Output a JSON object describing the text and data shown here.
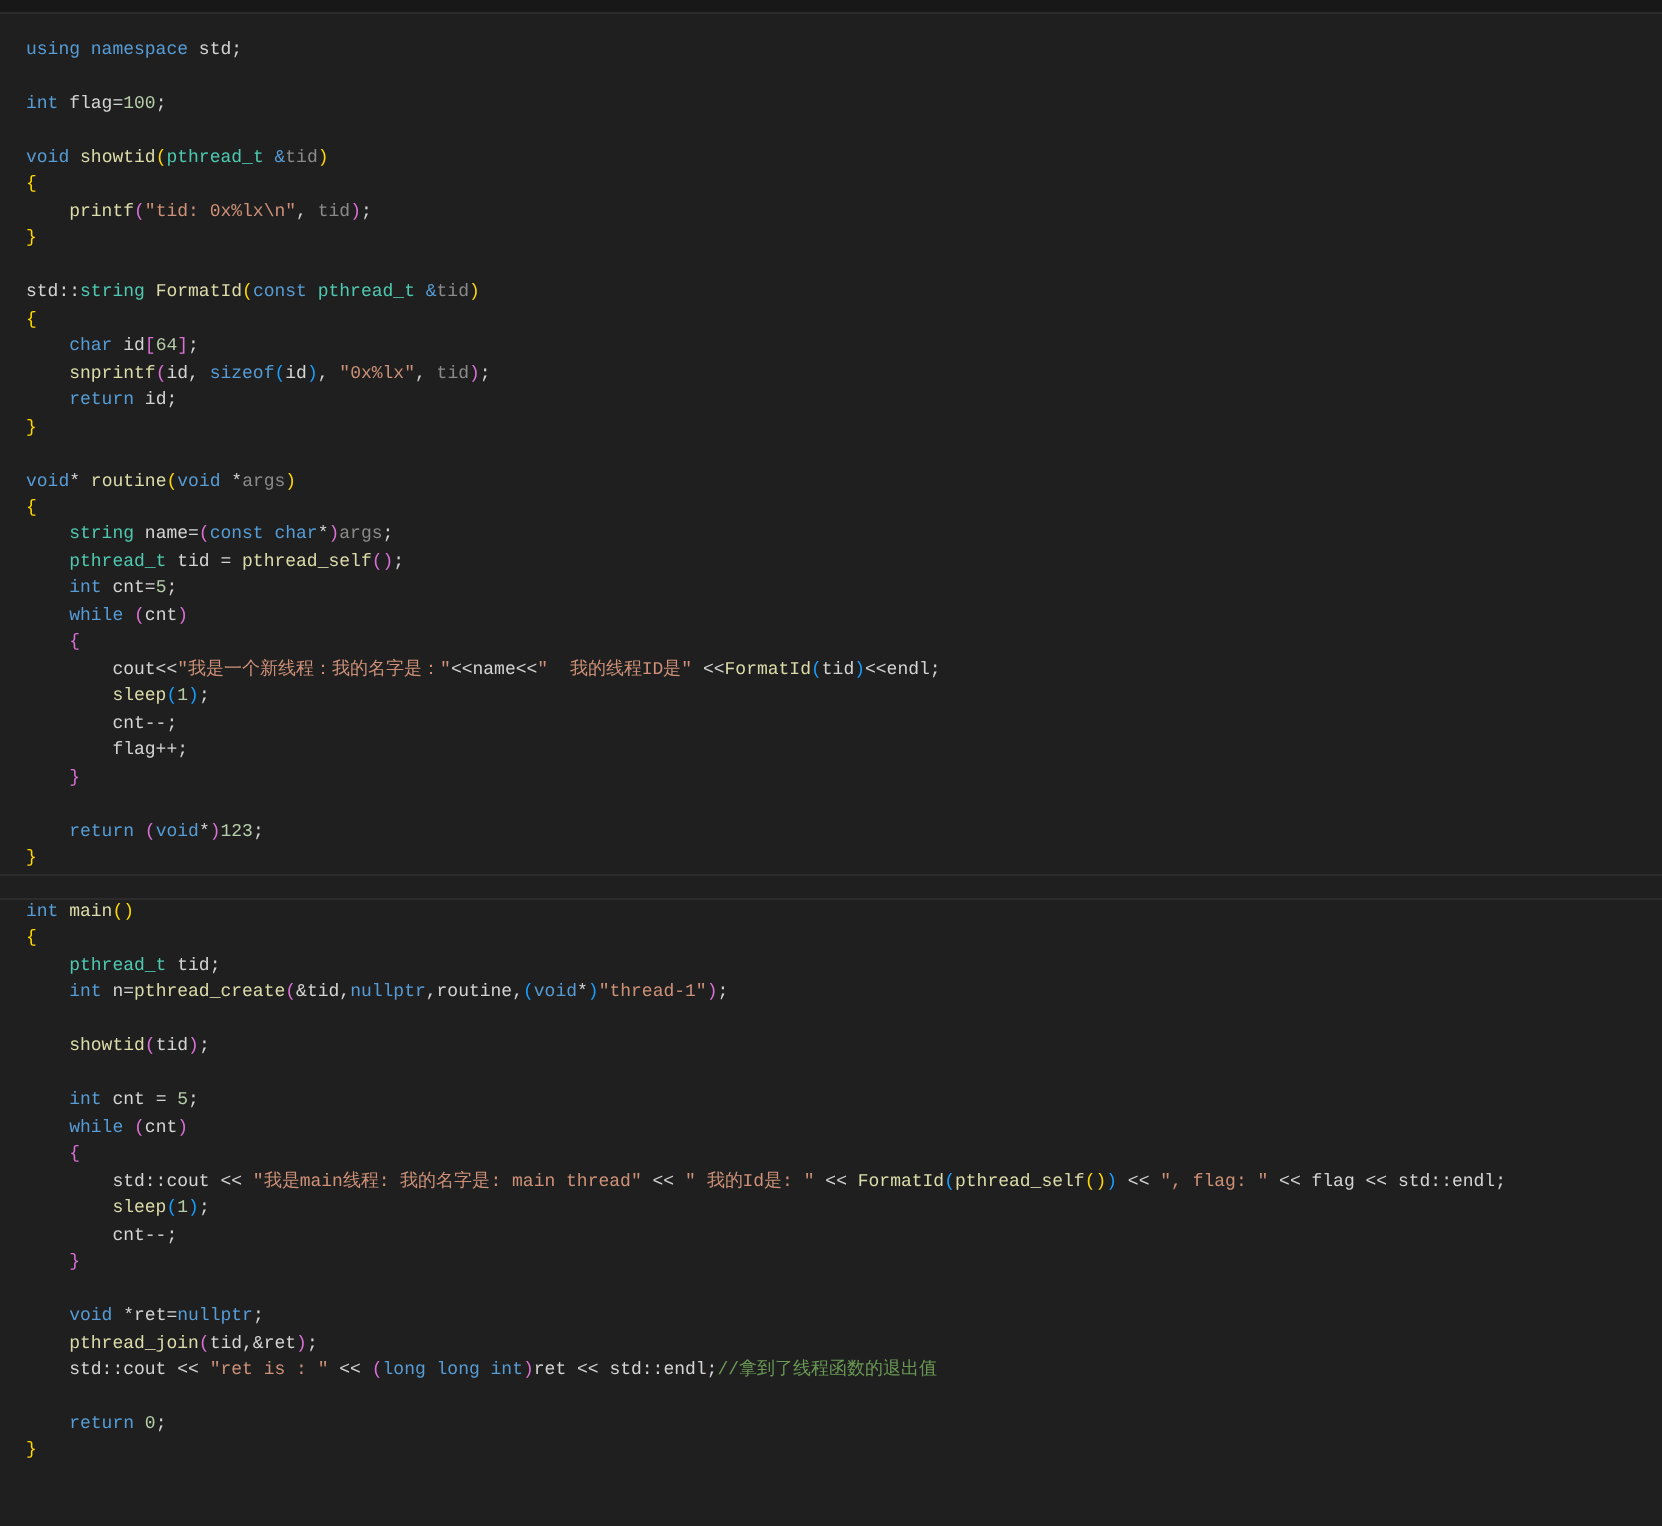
{
  "editor": {
    "lines": [
      {
        "kind": "code",
        "current": false,
        "tokens": [
          {
            "kind": "kw",
            "text": "using "
          },
          {
            "kind": "kw",
            "text": "namespace"
          },
          {
            "kind": "txt",
            "text": " std;"
          }
        ]
      },
      {
        "kind": "blank",
        "current": false
      },
      {
        "kind": "code",
        "current": false,
        "tokens": [
          {
            "kind": "kw",
            "text": "int"
          },
          {
            "kind": "txt",
            "text": " flag="
          },
          {
            "kind": "num",
            "text": "100"
          },
          {
            "kind": "txt",
            "text": ";"
          }
        ]
      },
      {
        "kind": "blank",
        "current": false
      },
      {
        "kind": "code",
        "current": false,
        "tokens": [
          {
            "kind": "kw",
            "text": "void "
          },
          {
            "kind": "fn",
            "text": "showtid"
          },
          {
            "kind": "b1",
            "text": "("
          },
          {
            "kind": "type",
            "text": "pthread_t "
          },
          {
            "kind": "kw",
            "text": "&"
          },
          {
            "kind": "dim",
            "text": "tid"
          },
          {
            "kind": "b1",
            "text": ")"
          }
        ]
      },
      {
        "kind": "code",
        "current": false,
        "tokens": [
          {
            "kind": "b1",
            "text": "{"
          }
        ]
      },
      {
        "kind": "code",
        "current": false,
        "tokens": [
          {
            "kind": "fn",
            "text": "    printf"
          },
          {
            "kind": "b2",
            "text": "("
          },
          {
            "kind": "str",
            "text": "\"tid: 0x%lx\\n\""
          },
          {
            "kind": "txt",
            "text": ", "
          },
          {
            "kind": "dim",
            "text": "tid"
          },
          {
            "kind": "b2",
            "text": ")"
          },
          {
            "kind": "txt",
            "text": ";"
          }
        ]
      },
      {
        "kind": "code",
        "current": false,
        "tokens": [
          {
            "kind": "b1",
            "text": "}"
          }
        ]
      },
      {
        "kind": "blank",
        "current": false
      },
      {
        "kind": "code",
        "current": false,
        "tokens": [
          {
            "kind": "txt",
            "text": "std::"
          },
          {
            "kind": "type",
            "text": "string "
          },
          {
            "kind": "fn",
            "text": "FormatId"
          },
          {
            "kind": "b1",
            "text": "("
          },
          {
            "kind": "kw",
            "text": "const "
          },
          {
            "kind": "type",
            "text": "pthread_t "
          },
          {
            "kind": "kw",
            "text": "&"
          },
          {
            "kind": "dim",
            "text": "tid"
          },
          {
            "kind": "b1",
            "text": ")"
          }
        ]
      },
      {
        "kind": "code",
        "current": false,
        "tokens": [
          {
            "kind": "b1",
            "text": "{"
          }
        ]
      },
      {
        "kind": "code",
        "current": false,
        "tokens": [
          {
            "kind": "kw",
            "text": "    char"
          },
          {
            "kind": "txt",
            "text": " id"
          },
          {
            "kind": "b2",
            "text": "["
          },
          {
            "kind": "num",
            "text": "64"
          },
          {
            "kind": "b2",
            "text": "]"
          },
          {
            "kind": "txt",
            "text": ";"
          }
        ]
      },
      {
        "kind": "code",
        "current": false,
        "tokens": [
          {
            "kind": "fn",
            "text": "    snprintf"
          },
          {
            "kind": "b2",
            "text": "("
          },
          {
            "kind": "txt",
            "text": "id, "
          },
          {
            "kind": "kw",
            "text": "sizeof"
          },
          {
            "kind": "b3",
            "text": "("
          },
          {
            "kind": "txt",
            "text": "id"
          },
          {
            "kind": "b3",
            "text": ")"
          },
          {
            "kind": "txt",
            "text": ", "
          },
          {
            "kind": "str",
            "text": "\"0x%lx\""
          },
          {
            "kind": "txt",
            "text": ", "
          },
          {
            "kind": "dim",
            "text": "tid"
          },
          {
            "kind": "b2",
            "text": ")"
          },
          {
            "kind": "txt",
            "text": ";"
          }
        ]
      },
      {
        "kind": "code",
        "current": false,
        "tokens": [
          {
            "kind": "kw",
            "text": "    return"
          },
          {
            "kind": "txt",
            "text": " id;"
          }
        ]
      },
      {
        "kind": "code",
        "current": false,
        "tokens": [
          {
            "kind": "b1",
            "text": "}"
          }
        ]
      },
      {
        "kind": "blank",
        "current": false
      },
      {
        "kind": "code",
        "current": false,
        "tokens": [
          {
            "kind": "kw",
            "text": "void"
          },
          {
            "kind": "txt",
            "text": "* "
          },
          {
            "kind": "fn",
            "text": "routine"
          },
          {
            "kind": "b1",
            "text": "("
          },
          {
            "kind": "kw",
            "text": "void"
          },
          {
            "kind": "txt",
            "text": " *"
          },
          {
            "kind": "dim",
            "text": "args"
          },
          {
            "kind": "b1",
            "text": ")"
          }
        ]
      },
      {
        "kind": "code",
        "current": false,
        "tokens": [
          {
            "kind": "b1",
            "text": "{"
          }
        ]
      },
      {
        "kind": "code",
        "current": false,
        "tokens": [
          {
            "kind": "type",
            "text": "    string"
          },
          {
            "kind": "txt",
            "text": " name="
          },
          {
            "kind": "b2",
            "text": "("
          },
          {
            "kind": "kw",
            "text": "const "
          },
          {
            "kind": "kw",
            "text": "char"
          },
          {
            "kind": "txt",
            "text": "*"
          },
          {
            "kind": "b2",
            "text": ")"
          },
          {
            "kind": "dim",
            "text": "args"
          },
          {
            "kind": "txt",
            "text": ";"
          }
        ]
      },
      {
        "kind": "code",
        "current": false,
        "tokens": [
          {
            "kind": "type",
            "text": "    pthread_t"
          },
          {
            "kind": "txt",
            "text": " tid = "
          },
          {
            "kind": "fn",
            "text": "pthread_self"
          },
          {
            "kind": "b2",
            "text": "()"
          },
          {
            "kind": "txt",
            "text": ";"
          }
        ]
      },
      {
        "kind": "code",
        "current": false,
        "tokens": [
          {
            "kind": "kw",
            "text": "    int"
          },
          {
            "kind": "txt",
            "text": " cnt="
          },
          {
            "kind": "num",
            "text": "5"
          },
          {
            "kind": "txt",
            "text": ";"
          }
        ]
      },
      {
        "kind": "code",
        "current": false,
        "tokens": [
          {
            "kind": "kw",
            "text": "    while "
          },
          {
            "kind": "b2",
            "text": "("
          },
          {
            "kind": "txt",
            "text": "cnt"
          },
          {
            "kind": "b2",
            "text": ")"
          }
        ]
      },
      {
        "kind": "code",
        "current": false,
        "tokens": [
          {
            "kind": "b2",
            "text": "    {"
          }
        ]
      },
      {
        "kind": "code",
        "current": false,
        "tokens": [
          {
            "kind": "txt",
            "text": "        cout<<"
          },
          {
            "kind": "str",
            "text": "\"我是一个新线程：我的名字是：\""
          },
          {
            "kind": "txt",
            "text": "<<name<<"
          },
          {
            "kind": "str",
            "text": "\"  我的线程ID是\""
          },
          {
            "kind": "txt",
            "text": " <<"
          },
          {
            "kind": "fn",
            "text": "FormatId"
          },
          {
            "kind": "b3",
            "text": "("
          },
          {
            "kind": "txt",
            "text": "tid"
          },
          {
            "kind": "b3",
            "text": ")"
          },
          {
            "kind": "txt",
            "text": "<<endl;"
          }
        ]
      },
      {
        "kind": "code",
        "current": false,
        "tokens": [
          {
            "kind": "fn",
            "text": "        sleep"
          },
          {
            "kind": "b3",
            "text": "("
          },
          {
            "kind": "num",
            "text": "1"
          },
          {
            "kind": "b3",
            "text": ")"
          },
          {
            "kind": "txt",
            "text": ";"
          }
        ]
      },
      {
        "kind": "code",
        "current": false,
        "tokens": [
          {
            "kind": "txt",
            "text": "        cnt--;"
          }
        ]
      },
      {
        "kind": "code",
        "current": false,
        "tokens": [
          {
            "kind": "txt",
            "text": "        flag++;"
          }
        ]
      },
      {
        "kind": "code",
        "current": false,
        "tokens": [
          {
            "kind": "b2",
            "text": "    }"
          }
        ]
      },
      {
        "kind": "blank",
        "current": false
      },
      {
        "kind": "code",
        "current": false,
        "tokens": [
          {
            "kind": "kw",
            "text": "    return "
          },
          {
            "kind": "b2",
            "text": "("
          },
          {
            "kind": "kw",
            "text": "void"
          },
          {
            "kind": "txt",
            "text": "*"
          },
          {
            "kind": "b2",
            "text": ")"
          },
          {
            "kind": "num",
            "text": "123"
          },
          {
            "kind": "txt",
            "text": ";"
          }
        ]
      },
      {
        "kind": "code",
        "current": false,
        "tokens": [
          {
            "kind": "b1",
            "text": "}"
          }
        ]
      },
      {
        "kind": "blank",
        "current": true
      },
      {
        "kind": "code",
        "current": false,
        "tokens": [
          {
            "kind": "kw",
            "text": "int "
          },
          {
            "kind": "fn",
            "text": "main"
          },
          {
            "kind": "b1",
            "text": "()"
          }
        ]
      },
      {
        "kind": "code",
        "current": false,
        "tokens": [
          {
            "kind": "b1",
            "text": "{"
          }
        ]
      },
      {
        "kind": "code",
        "current": false,
        "tokens": [
          {
            "kind": "type",
            "text": "    pthread_t"
          },
          {
            "kind": "txt",
            "text": " tid;"
          }
        ]
      },
      {
        "kind": "code",
        "current": false,
        "tokens": [
          {
            "kind": "kw",
            "text": "    int"
          },
          {
            "kind": "txt",
            "text": " n="
          },
          {
            "kind": "fn",
            "text": "pthread_create"
          },
          {
            "kind": "b2",
            "text": "("
          },
          {
            "kind": "txt",
            "text": "&tid,"
          },
          {
            "kind": "kw",
            "text": "nullptr"
          },
          {
            "kind": "txt",
            "text": ",routine,"
          },
          {
            "kind": "b3",
            "text": "("
          },
          {
            "kind": "kw",
            "text": "void"
          },
          {
            "kind": "txt",
            "text": "*"
          },
          {
            "kind": "b3",
            "text": ")"
          },
          {
            "kind": "str",
            "text": "\"thread-1\""
          },
          {
            "kind": "b2",
            "text": ")"
          },
          {
            "kind": "txt",
            "text": ";"
          }
        ]
      },
      {
        "kind": "blank",
        "current": false
      },
      {
        "kind": "code",
        "current": false,
        "tokens": [
          {
            "kind": "fn",
            "text": "    showtid"
          },
          {
            "kind": "b2",
            "text": "("
          },
          {
            "kind": "txt",
            "text": "tid"
          },
          {
            "kind": "b2",
            "text": ")"
          },
          {
            "kind": "txt",
            "text": ";"
          }
        ]
      },
      {
        "kind": "blank",
        "current": false
      },
      {
        "kind": "code",
        "current": false,
        "tokens": [
          {
            "kind": "kw",
            "text": "    int"
          },
          {
            "kind": "txt",
            "text": " cnt = "
          },
          {
            "kind": "num",
            "text": "5"
          },
          {
            "kind": "txt",
            "text": ";"
          }
        ]
      },
      {
        "kind": "code",
        "current": false,
        "tokens": [
          {
            "kind": "kw",
            "text": "    while "
          },
          {
            "kind": "b2",
            "text": "("
          },
          {
            "kind": "txt",
            "text": "cnt"
          },
          {
            "kind": "b2",
            "text": ")"
          }
        ]
      },
      {
        "kind": "code",
        "current": false,
        "tokens": [
          {
            "kind": "b2",
            "text": "    {"
          }
        ]
      },
      {
        "kind": "code",
        "current": false,
        "tokens": [
          {
            "kind": "txt",
            "text": "        std::cout << "
          },
          {
            "kind": "str",
            "text": "\"我是main线程: 我的名字是: main thread\""
          },
          {
            "kind": "txt",
            "text": " << "
          },
          {
            "kind": "str",
            "text": "\" 我的Id是: \""
          },
          {
            "kind": "txt",
            "text": " << "
          },
          {
            "kind": "fn",
            "text": "FormatId"
          },
          {
            "kind": "b3",
            "text": "("
          },
          {
            "kind": "fn",
            "text": "pthread_self"
          },
          {
            "kind": "b1",
            "text": "()"
          },
          {
            "kind": "b3",
            "text": ")"
          },
          {
            "kind": "txt",
            "text": " << "
          },
          {
            "kind": "str",
            "text": "\", flag: \""
          },
          {
            "kind": "txt",
            "text": " << flag << std::endl;"
          }
        ]
      },
      {
        "kind": "code",
        "current": false,
        "tokens": [
          {
            "kind": "fn",
            "text": "        sleep"
          },
          {
            "kind": "b3",
            "text": "("
          },
          {
            "kind": "num",
            "text": "1"
          },
          {
            "kind": "b3",
            "text": ")"
          },
          {
            "kind": "txt",
            "text": ";"
          }
        ]
      },
      {
        "kind": "code",
        "current": false,
        "tokens": [
          {
            "kind": "txt",
            "text": "        cnt--;"
          }
        ]
      },
      {
        "kind": "code",
        "current": false,
        "tokens": [
          {
            "kind": "b2",
            "text": "    }"
          }
        ]
      },
      {
        "kind": "blank",
        "current": false
      },
      {
        "kind": "code",
        "current": false,
        "tokens": [
          {
            "kind": "kw",
            "text": "    void"
          },
          {
            "kind": "txt",
            "text": " *ret="
          },
          {
            "kind": "kw",
            "text": "nullptr"
          },
          {
            "kind": "txt",
            "text": ";"
          }
        ]
      },
      {
        "kind": "code",
        "current": false,
        "tokens": [
          {
            "kind": "fn",
            "text": "    pthread_join"
          },
          {
            "kind": "b2",
            "text": "("
          },
          {
            "kind": "txt",
            "text": "tid,&ret"
          },
          {
            "kind": "b2",
            "text": ")"
          },
          {
            "kind": "txt",
            "text": ";"
          }
        ]
      },
      {
        "kind": "code",
        "current": false,
        "tokens": [
          {
            "kind": "txt",
            "text": "    std::cout << "
          },
          {
            "kind": "str",
            "text": "\"ret is : \""
          },
          {
            "kind": "txt",
            "text": " << "
          },
          {
            "kind": "b2",
            "text": "("
          },
          {
            "kind": "kw",
            "text": "long long int"
          },
          {
            "kind": "b2",
            "text": ")"
          },
          {
            "kind": "txt",
            "text": "ret << std::endl;"
          },
          {
            "kind": "cmt",
            "text": "//拿到了线程函数的退出值"
          }
        ]
      },
      {
        "kind": "blank",
        "current": false
      },
      {
        "kind": "code",
        "current": false,
        "tokens": [
          {
            "kind": "kw",
            "text": "    return "
          },
          {
            "kind": "num",
            "text": "0"
          },
          {
            "kind": "txt",
            "text": ";"
          }
        ]
      },
      {
        "kind": "code",
        "current": false,
        "tokens": [
          {
            "kind": "b1",
            "text": "}"
          }
        ]
      }
    ]
  }
}
